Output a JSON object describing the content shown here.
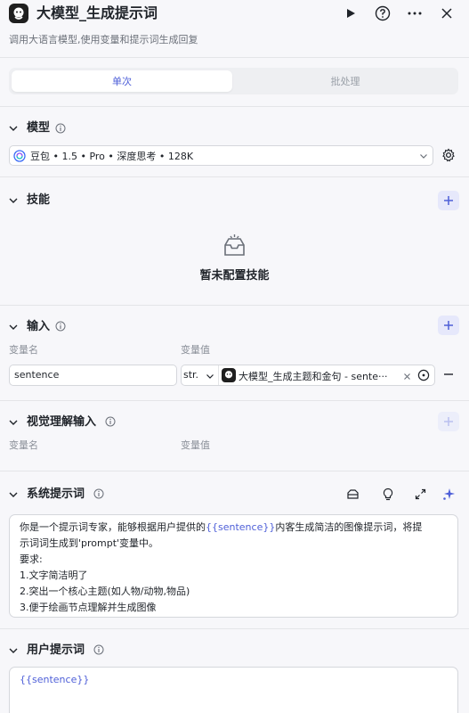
{
  "header": {
    "title": "大模型_生成提示词",
    "subtitle": "调用大语言模型,使用变量和提示词生成回复"
  },
  "tabs": [
    {
      "label": "单次",
      "active": true
    },
    {
      "label": "批处理",
      "active": false
    }
  ],
  "model_section": {
    "title": "模型",
    "selected_model": "豆包 • 1.5 • Pro • 深度思考 • 128K"
  },
  "skills_section": {
    "title": "技能",
    "empty_text": "暂未配置技能"
  },
  "input_section": {
    "title": "输入",
    "col_name": "变量名",
    "col_value": "变量值",
    "rows": [
      {
        "name": "sentence",
        "type": "str.",
        "ref": "大模型_生成主题和金句 - sente···"
      }
    ]
  },
  "vision_section": {
    "title": "视觉理解输入",
    "col_name": "变量名",
    "col_value": "变量值"
  },
  "system_prompt": {
    "title": "系统提示词",
    "line1_a": "你是一个提示词专家，能够根据用户提供的",
    "line1_var": "{{sentence}}",
    "line1_b": "内客生成简洁的图像提示词，将提",
    "line2": "示词词生成到'prompt'变量中。",
    "line3": "要求:",
    "line4": "1.文字简洁明了",
    "line5": "2.突出一个核心主题(如人物/动物,物品)",
    "line6": "3.便于绘画节点理解并生成图像"
  },
  "user_prompt": {
    "title": "用户提示词",
    "content": "{{sentence}}"
  },
  "colors": {
    "accent": "#4e5fd8",
    "background": "#f7f7fa",
    "border": "#d5d7dc"
  }
}
